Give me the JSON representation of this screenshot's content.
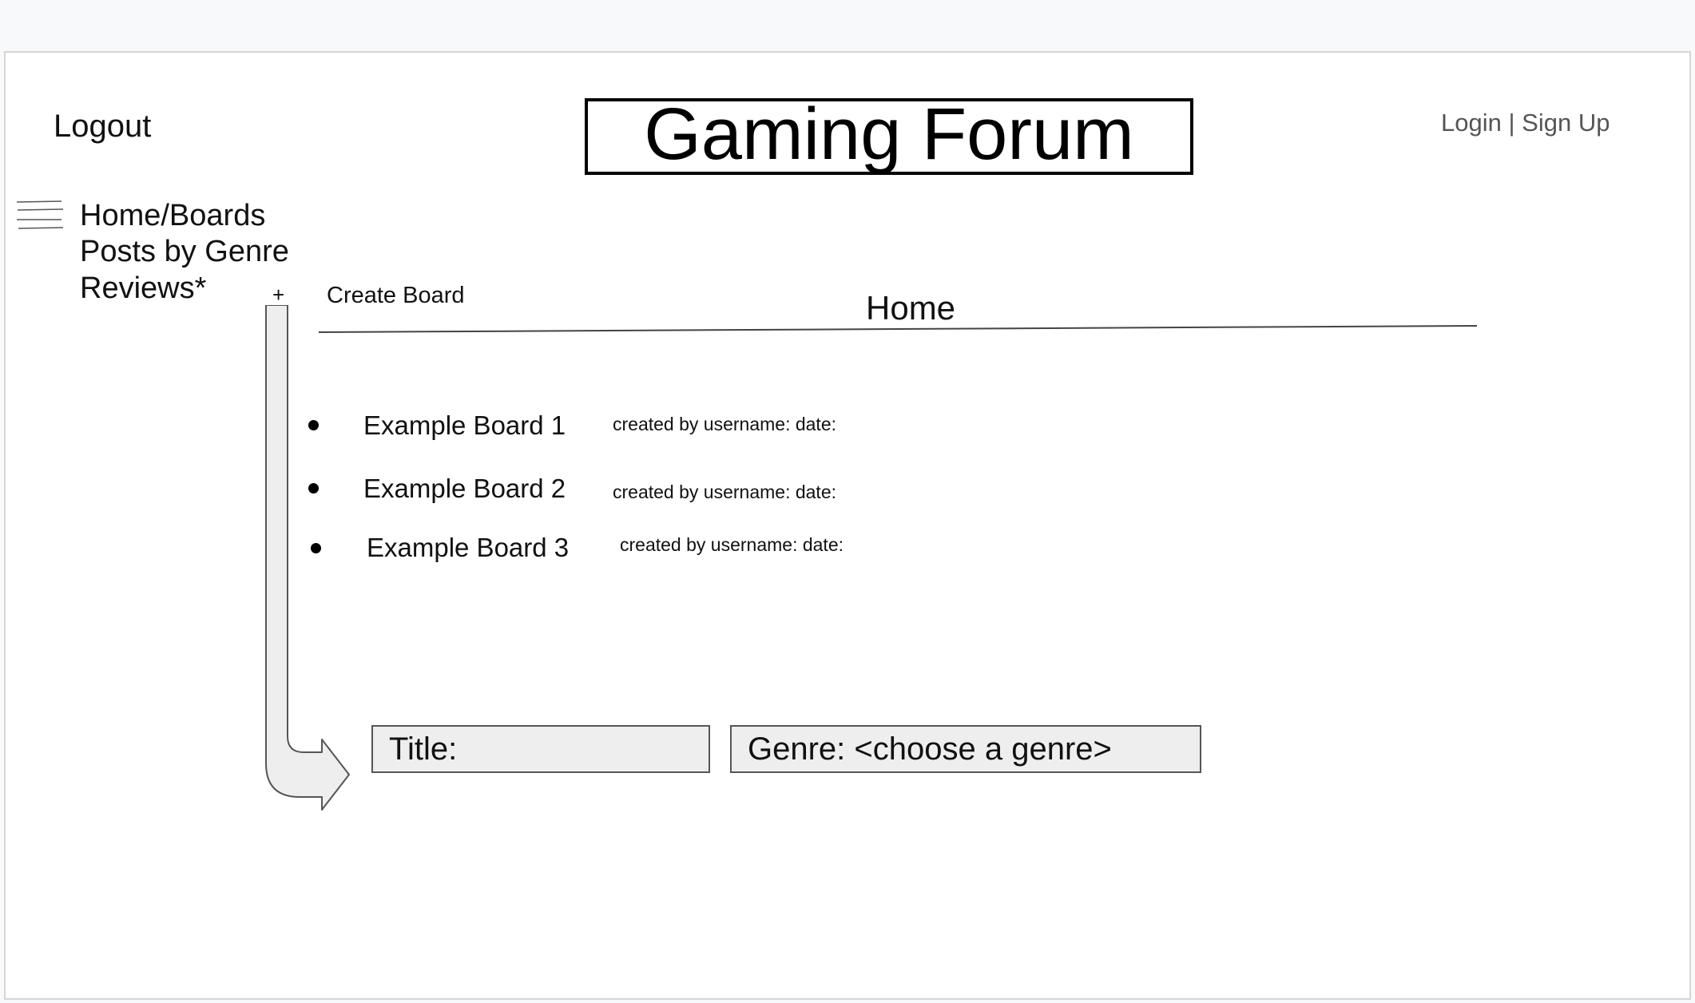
{
  "header": {
    "logout_label": "Logout",
    "site_title": "Gaming Forum",
    "login_label": "Login",
    "auth_separator": "|",
    "signup_label": "Sign Up"
  },
  "sidebar": {
    "menu_icon": "hamburger-menu-icon",
    "items": [
      {
        "label": "Home/Boards"
      },
      {
        "label": "Posts by Genre"
      },
      {
        "label": "Reviews*"
      }
    ]
  },
  "main": {
    "create_icon": "plus-icon",
    "create_symbol": "+",
    "create_label": "Create Board",
    "heading": "Home",
    "boards": [
      {
        "name": "Example Board 1",
        "meta": "created by username: date:"
      },
      {
        "name": "Example Board 2",
        "meta": "created by username: date:"
      },
      {
        "name": "Example Board 3",
        "meta": "created by username: date:"
      }
    ]
  },
  "create_form": {
    "title_placeholder": "Title:",
    "genre_placeholder": "Genre: <choose a genre>"
  },
  "colors": {
    "background": "#f8f9fa",
    "canvas": "#ffffff",
    "field_fill": "#eeeeee",
    "muted_text": "#555555"
  }
}
